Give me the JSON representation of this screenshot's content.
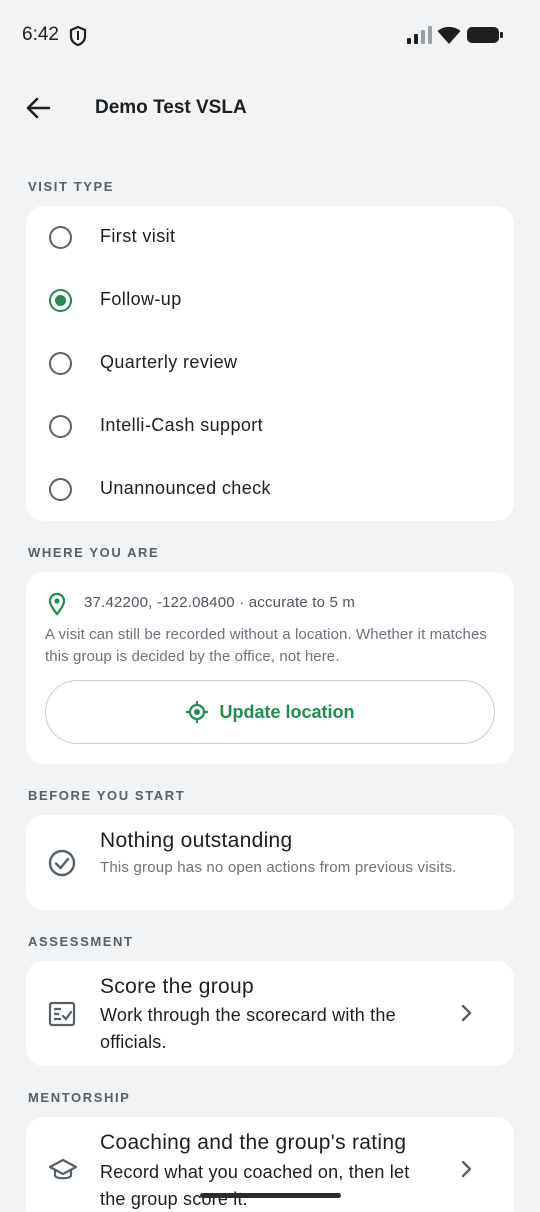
{
  "status_bar": {
    "time": "6:42",
    "icons": [
      "shield-icon",
      "signal-icon",
      "wifi-icon",
      "battery-icon"
    ]
  },
  "app_bar": {
    "back_icon": "arrow-back-icon",
    "title": "Demo Test VSLA"
  },
  "visit_type": {
    "label": "VISIT TYPE",
    "options": [
      {
        "label": "First visit",
        "selected": false
      },
      {
        "label": "Follow-up",
        "selected": true
      },
      {
        "label": "Quarterly review",
        "selected": false
      },
      {
        "label": "Intelli-Cash support",
        "selected": false
      },
      {
        "label": "Unannounced check",
        "selected": false
      }
    ]
  },
  "location": {
    "label": "WHERE YOU ARE",
    "coords": "37.42200, -122.08400 · accurate to 5 m",
    "note": "A visit can still be recorded without a location. Whether it matches this group is decided by the office, not here.",
    "button_label": "Update location"
  },
  "before_start": {
    "label": "BEFORE YOU START",
    "title": "Nothing outstanding",
    "subtitle": "This group has no open actions from previous visits."
  },
  "assessment": {
    "label": "ASSESSMENT",
    "title": "Score the group",
    "subtitle": "Work through the scorecard with the officials."
  },
  "mentorship": {
    "label": "MENTORSHIP",
    "title": "Coaching and the group's rating",
    "subtitle": "Record what you coached on, then let the group score it."
  },
  "colors": {
    "accent": "#1e8e4e",
    "background": "#f1f3f4",
    "card": "#ffffff"
  }
}
